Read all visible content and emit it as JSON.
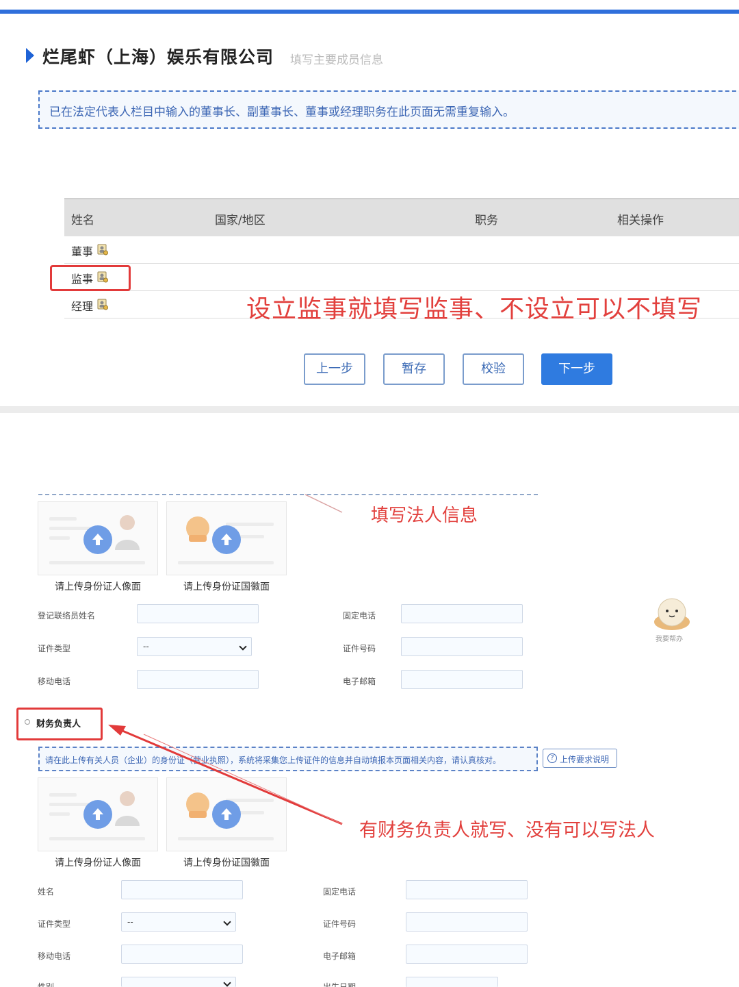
{
  "header": {
    "company_name": "烂尾虾（上海）娱乐有限公司",
    "subtitle": "填写主要成员信息"
  },
  "notice_top": "已在法定代表人栏目中输入的董事长、副董事长、董事或经理职务在此页面无需重复输入。",
  "table": {
    "columns": [
      "姓名",
      "国家/地区",
      "职务",
      "相关操作"
    ],
    "rows": [
      {
        "label": "董事",
        "icon": "person-add-icon"
      },
      {
        "label": "监事",
        "icon": "person-add-icon"
      },
      {
        "label": "经理",
        "icon": "person-add-icon"
      }
    ]
  },
  "annotations": {
    "supervisor_note": "设立监事就填写监事、不设立可以不填写",
    "legal_person_note": "填写法人信息",
    "finance_note": "有财务负责人就写、没有可以写法人"
  },
  "buttons": {
    "prev": "上一步",
    "save": "暂存",
    "check": "校验",
    "next": "下一步"
  },
  "upload_cards": {
    "front_caption": "请上传身份证人像面",
    "back_caption": "请上传身份证国徽面"
  },
  "contact_form": {
    "name_label": "登记联络员姓名",
    "phone_label": "固定电话",
    "id_type_label": "证件类型",
    "id_type_value": "--",
    "id_no_label": "证件号码",
    "mobile_label": "移动电话",
    "email_label": "电子邮箱"
  },
  "helper": {
    "label": "我要帮办"
  },
  "finance_section": {
    "title": "财务负责人",
    "notice": "请在此上传有关人员（企业）的身份证（营业执照），系统将采集您上传证件的信息并自动填报本页面相关内容，请认真核对。",
    "requirement_link": "上传要求说明",
    "name_label": "姓名",
    "phone_label": "固定电话",
    "id_type_label": "证件类型",
    "id_type_value": "--",
    "id_no_label": "证件号码",
    "mobile_label": "移动电话",
    "email_label": "电子邮箱",
    "gender_label": "性别",
    "birth_label": "出生日期"
  },
  "colors": {
    "accent_blue": "#2f6fdb",
    "annotation_red": "#e2403d",
    "primary_button": "#2f7be0"
  }
}
